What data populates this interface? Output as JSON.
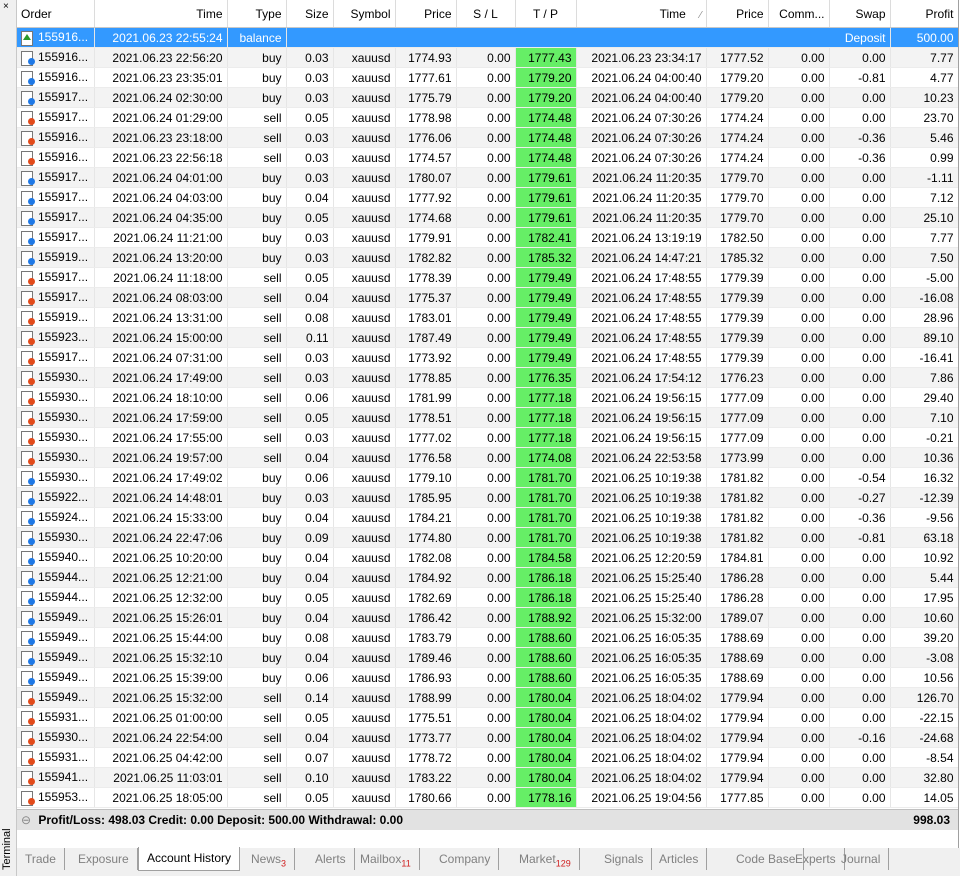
{
  "window": {
    "side_label": "Terminal",
    "close_glyph": "×"
  },
  "columns": [
    "Order",
    "Time",
    "Type",
    "Size",
    "Symbol",
    "Price",
    "S / L",
    "T / P",
    "Time",
    "Price",
    "Comm...",
    "Swap",
    "Profit"
  ],
  "sort_indicator": "⁄",
  "balance_row": {
    "order": "155916...",
    "time": "2021.06.23 22:55:24",
    "type": "balance",
    "comment": "Deposit",
    "profit": "500.00"
  },
  "rows": [
    [
      "155916...",
      "2021.06.23 22:56:20",
      "buy",
      "0.03",
      "xauusd",
      "1774.93",
      "0.00",
      "1777.43",
      "2021.06.23 23:34:17",
      "1777.52",
      "0.00",
      "0.00",
      "7.77"
    ],
    [
      "155916...",
      "2021.06.23 23:35:01",
      "buy",
      "0.03",
      "xauusd",
      "1777.61",
      "0.00",
      "1779.20",
      "2021.06.24 04:00:40",
      "1779.20",
      "0.00",
      "-0.81",
      "4.77"
    ],
    [
      "155917...",
      "2021.06.24 02:30:00",
      "buy",
      "0.03",
      "xauusd",
      "1775.79",
      "0.00",
      "1779.20",
      "2021.06.24 04:00:40",
      "1779.20",
      "0.00",
      "0.00",
      "10.23"
    ],
    [
      "155917...",
      "2021.06.24 01:29:00",
      "sell",
      "0.05",
      "xauusd",
      "1778.98",
      "0.00",
      "1774.48",
      "2021.06.24 07:30:26",
      "1774.24",
      "0.00",
      "0.00",
      "23.70"
    ],
    [
      "155916...",
      "2021.06.23 23:18:00",
      "sell",
      "0.03",
      "xauusd",
      "1776.06",
      "0.00",
      "1774.48",
      "2021.06.24 07:30:26",
      "1774.24",
      "0.00",
      "-0.36",
      "5.46"
    ],
    [
      "155916...",
      "2021.06.23 22:56:18",
      "sell",
      "0.03",
      "xauusd",
      "1774.57",
      "0.00",
      "1774.48",
      "2021.06.24 07:30:26",
      "1774.24",
      "0.00",
      "-0.36",
      "0.99"
    ],
    [
      "155917...",
      "2021.06.24 04:01:00",
      "buy",
      "0.03",
      "xauusd",
      "1780.07",
      "0.00",
      "1779.61",
      "2021.06.24 11:20:35",
      "1779.70",
      "0.00",
      "0.00",
      "-1.11"
    ],
    [
      "155917...",
      "2021.06.24 04:03:00",
      "buy",
      "0.04",
      "xauusd",
      "1777.92",
      "0.00",
      "1779.61",
      "2021.06.24 11:20:35",
      "1779.70",
      "0.00",
      "0.00",
      "7.12"
    ],
    [
      "155917...",
      "2021.06.24 04:35:00",
      "buy",
      "0.05",
      "xauusd",
      "1774.68",
      "0.00",
      "1779.61",
      "2021.06.24 11:20:35",
      "1779.70",
      "0.00",
      "0.00",
      "25.10"
    ],
    [
      "155917...",
      "2021.06.24 11:21:00",
      "buy",
      "0.03",
      "xauusd",
      "1779.91",
      "0.00",
      "1782.41",
      "2021.06.24 13:19:19",
      "1782.50",
      "0.00",
      "0.00",
      "7.77"
    ],
    [
      "155919...",
      "2021.06.24 13:20:00",
      "buy",
      "0.03",
      "xauusd",
      "1782.82",
      "0.00",
      "1785.32",
      "2021.06.24 14:47:21",
      "1785.32",
      "0.00",
      "0.00",
      "7.50"
    ],
    [
      "155917...",
      "2021.06.24 11:18:00",
      "sell",
      "0.05",
      "xauusd",
      "1778.39",
      "0.00",
      "1779.49",
      "2021.06.24 17:48:55",
      "1779.39",
      "0.00",
      "0.00",
      "-5.00"
    ],
    [
      "155917...",
      "2021.06.24 08:03:00",
      "sell",
      "0.04",
      "xauusd",
      "1775.37",
      "0.00",
      "1779.49",
      "2021.06.24 17:48:55",
      "1779.39",
      "0.00",
      "0.00",
      "-16.08"
    ],
    [
      "155919...",
      "2021.06.24 13:31:00",
      "sell",
      "0.08",
      "xauusd",
      "1783.01",
      "0.00",
      "1779.49",
      "2021.06.24 17:48:55",
      "1779.39",
      "0.00",
      "0.00",
      "28.96"
    ],
    [
      "155923...",
      "2021.06.24 15:00:00",
      "sell",
      "0.11",
      "xauusd",
      "1787.49",
      "0.00",
      "1779.49",
      "2021.06.24 17:48:55",
      "1779.39",
      "0.00",
      "0.00",
      "89.10"
    ],
    [
      "155917...",
      "2021.06.24 07:31:00",
      "sell",
      "0.03",
      "xauusd",
      "1773.92",
      "0.00",
      "1779.49",
      "2021.06.24 17:48:55",
      "1779.39",
      "0.00",
      "0.00",
      "-16.41"
    ],
    [
      "155930...",
      "2021.06.24 17:49:00",
      "sell",
      "0.03",
      "xauusd",
      "1778.85",
      "0.00",
      "1776.35",
      "2021.06.24 17:54:12",
      "1776.23",
      "0.00",
      "0.00",
      "7.86"
    ],
    [
      "155930...",
      "2021.06.24 18:10:00",
      "sell",
      "0.06",
      "xauusd",
      "1781.99",
      "0.00",
      "1777.18",
      "2021.06.24 19:56:15",
      "1777.09",
      "0.00",
      "0.00",
      "29.40"
    ],
    [
      "155930...",
      "2021.06.24 17:59:00",
      "sell",
      "0.05",
      "xauusd",
      "1778.51",
      "0.00",
      "1777.18",
      "2021.06.24 19:56:15",
      "1777.09",
      "0.00",
      "0.00",
      "7.10"
    ],
    [
      "155930...",
      "2021.06.24 17:55:00",
      "sell",
      "0.03",
      "xauusd",
      "1777.02",
      "0.00",
      "1777.18",
      "2021.06.24 19:56:15",
      "1777.09",
      "0.00",
      "0.00",
      "-0.21"
    ],
    [
      "155930...",
      "2021.06.24 19:57:00",
      "sell",
      "0.04",
      "xauusd",
      "1776.58",
      "0.00",
      "1774.08",
      "2021.06.24 22:53:58",
      "1773.99",
      "0.00",
      "0.00",
      "10.36"
    ],
    [
      "155930...",
      "2021.06.24 17:49:02",
      "buy",
      "0.06",
      "xauusd",
      "1779.10",
      "0.00",
      "1781.70",
      "2021.06.25 10:19:38",
      "1781.82",
      "0.00",
      "-0.54",
      "16.32"
    ],
    [
      "155922...",
      "2021.06.24 14:48:01",
      "buy",
      "0.03",
      "xauusd",
      "1785.95",
      "0.00",
      "1781.70",
      "2021.06.25 10:19:38",
      "1781.82",
      "0.00",
      "-0.27",
      "-12.39"
    ],
    [
      "155924...",
      "2021.06.24 15:33:00",
      "buy",
      "0.04",
      "xauusd",
      "1784.21",
      "0.00",
      "1781.70",
      "2021.06.25 10:19:38",
      "1781.82",
      "0.00",
      "-0.36",
      "-9.56"
    ],
    [
      "155930...",
      "2021.06.24 22:47:06",
      "buy",
      "0.09",
      "xauusd",
      "1774.80",
      "0.00",
      "1781.70",
      "2021.06.25 10:19:38",
      "1781.82",
      "0.00",
      "-0.81",
      "63.18"
    ],
    [
      "155940...",
      "2021.06.25 10:20:00",
      "buy",
      "0.04",
      "xauusd",
      "1782.08",
      "0.00",
      "1784.58",
      "2021.06.25 12:20:59",
      "1784.81",
      "0.00",
      "0.00",
      "10.92"
    ],
    [
      "155944...",
      "2021.06.25 12:21:00",
      "buy",
      "0.04",
      "xauusd",
      "1784.92",
      "0.00",
      "1786.18",
      "2021.06.25 15:25:40",
      "1786.28",
      "0.00",
      "0.00",
      "5.44"
    ],
    [
      "155944...",
      "2021.06.25 12:32:00",
      "buy",
      "0.05",
      "xauusd",
      "1782.69",
      "0.00",
      "1786.18",
      "2021.06.25 15:25:40",
      "1786.28",
      "0.00",
      "0.00",
      "17.95"
    ],
    [
      "155949...",
      "2021.06.25 15:26:01",
      "buy",
      "0.04",
      "xauusd",
      "1786.42",
      "0.00",
      "1788.92",
      "2021.06.25 15:32:00",
      "1789.07",
      "0.00",
      "0.00",
      "10.60"
    ],
    [
      "155949...",
      "2021.06.25 15:44:00",
      "buy",
      "0.08",
      "xauusd",
      "1783.79",
      "0.00",
      "1788.60",
      "2021.06.25 16:05:35",
      "1788.69",
      "0.00",
      "0.00",
      "39.20"
    ],
    [
      "155949...",
      "2021.06.25 15:32:10",
      "buy",
      "0.04",
      "xauusd",
      "1789.46",
      "0.00",
      "1788.60",
      "2021.06.25 16:05:35",
      "1788.69",
      "0.00",
      "0.00",
      "-3.08"
    ],
    [
      "155949...",
      "2021.06.25 15:39:00",
      "buy",
      "0.06",
      "xauusd",
      "1786.93",
      "0.00",
      "1788.60",
      "2021.06.25 16:05:35",
      "1788.69",
      "0.00",
      "0.00",
      "10.56"
    ],
    [
      "155949...",
      "2021.06.25 15:32:00",
      "sell",
      "0.14",
      "xauusd",
      "1788.99",
      "0.00",
      "1780.04",
      "2021.06.25 18:04:02",
      "1779.94",
      "0.00",
      "0.00",
      "126.70"
    ],
    [
      "155931...",
      "2021.06.25 01:00:00",
      "sell",
      "0.05",
      "xauusd",
      "1775.51",
      "0.00",
      "1780.04",
      "2021.06.25 18:04:02",
      "1779.94",
      "0.00",
      "0.00",
      "-22.15"
    ],
    [
      "155930...",
      "2021.06.24 22:54:00",
      "sell",
      "0.04",
      "xauusd",
      "1773.77",
      "0.00",
      "1780.04",
      "2021.06.25 18:04:02",
      "1779.94",
      "0.00",
      "-0.16",
      "-24.68"
    ],
    [
      "155931...",
      "2021.06.25 04:42:00",
      "sell",
      "0.07",
      "xauusd",
      "1778.72",
      "0.00",
      "1780.04",
      "2021.06.25 18:04:02",
      "1779.94",
      "0.00",
      "0.00",
      "-8.54"
    ],
    [
      "155941...",
      "2021.06.25 11:03:01",
      "sell",
      "0.10",
      "xauusd",
      "1783.22",
      "0.00",
      "1780.04",
      "2021.06.25 18:04:02",
      "1779.94",
      "0.00",
      "0.00",
      "32.80"
    ],
    [
      "155953...",
      "2021.06.25 18:05:00",
      "sell",
      "0.05",
      "xauusd",
      "1780.66",
      "0.00",
      "1778.16",
      "2021.06.25 19:04:56",
      "1777.85",
      "0.00",
      "0.00",
      "14.05"
    ]
  ],
  "summary": {
    "text": "Profit/Loss: 498.03  Credit: 0.00  Deposit: 500.00  Withdrawal: 0.00",
    "total": "998.03",
    "collapse_glyph": "⊖"
  },
  "tabs": [
    {
      "label": "Trade",
      "badge": ""
    },
    {
      "label": "Exposure",
      "badge": ""
    },
    {
      "label": "Account History",
      "badge": "",
      "active": true
    },
    {
      "label": "News",
      "badge": "3"
    },
    {
      "label": "Alerts",
      "badge": ""
    },
    {
      "label": "Mailbox",
      "badge": "11"
    },
    {
      "label": "Company",
      "badge": ""
    },
    {
      "label": "Market",
      "badge": "129"
    },
    {
      "label": "Signals",
      "badge": ""
    },
    {
      "label": "Articles",
      "badge": ""
    },
    {
      "label": "Code Base",
      "badge": ""
    },
    {
      "label": "Experts",
      "badge": ""
    },
    {
      "label": "Journal",
      "badge": ""
    }
  ],
  "colors": {
    "selected_row": "#3399ff",
    "tp_highlight": "#66ee66",
    "buy_icon": "#1e78e6",
    "sell_icon": "#e24a1a"
  }
}
